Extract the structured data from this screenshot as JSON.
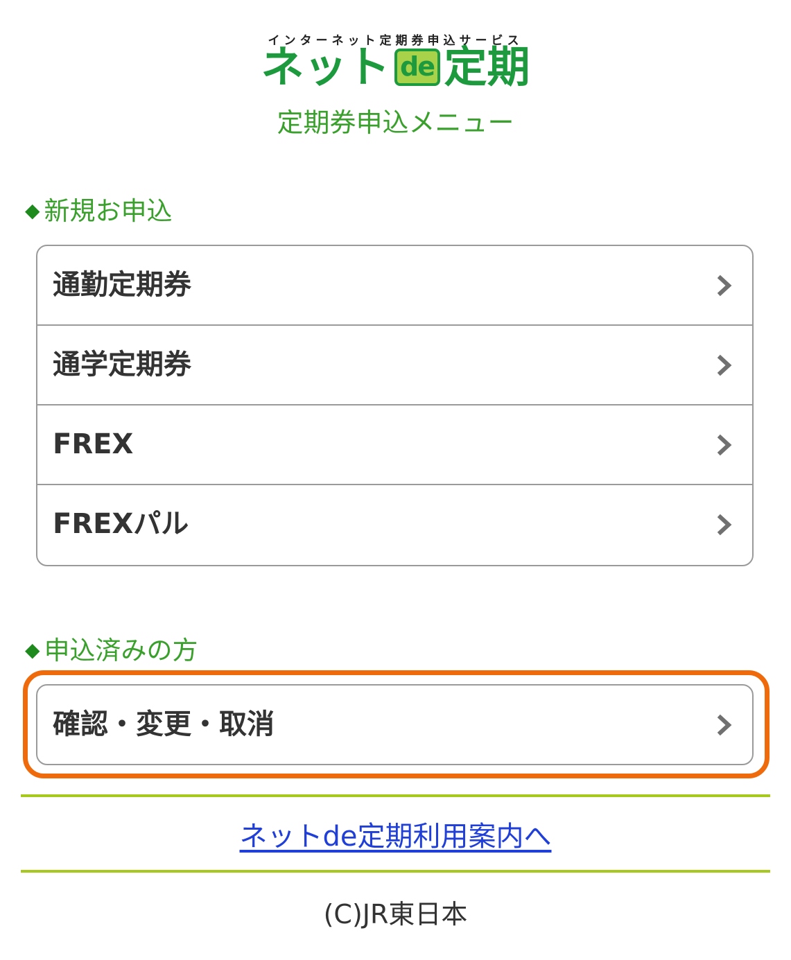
{
  "header": {
    "tagline": "インターネット定期券申込サービス",
    "logo_left": "ネット",
    "logo_de": "de",
    "logo_right": "定期",
    "menu_title": "定期券申込メニュー"
  },
  "sections": {
    "new": {
      "marker": "◆",
      "title": "新規お申込",
      "items": [
        {
          "label": "通勤定期券"
        },
        {
          "label": "通学定期券"
        },
        {
          "label": "FREX"
        },
        {
          "label": "FREXパル"
        }
      ]
    },
    "existing": {
      "marker": "◆",
      "title": "申込済みの方",
      "items": [
        {
          "label": "確認・変更・取消"
        }
      ]
    }
  },
  "footer": {
    "guide_link": "ネットde定期利用案内へ",
    "copyright": "(C)JR東日本"
  },
  "colors": {
    "section_green": "#3aa02c",
    "logo_green": "#1c9a3d",
    "highlight_orange": "#ee6a0a",
    "divider_green": "#a7c81f",
    "link_blue": "#1f3fd8"
  },
  "icons": {
    "item_arrow": "chevron-right-icon",
    "section_marker": "diamond-icon"
  }
}
